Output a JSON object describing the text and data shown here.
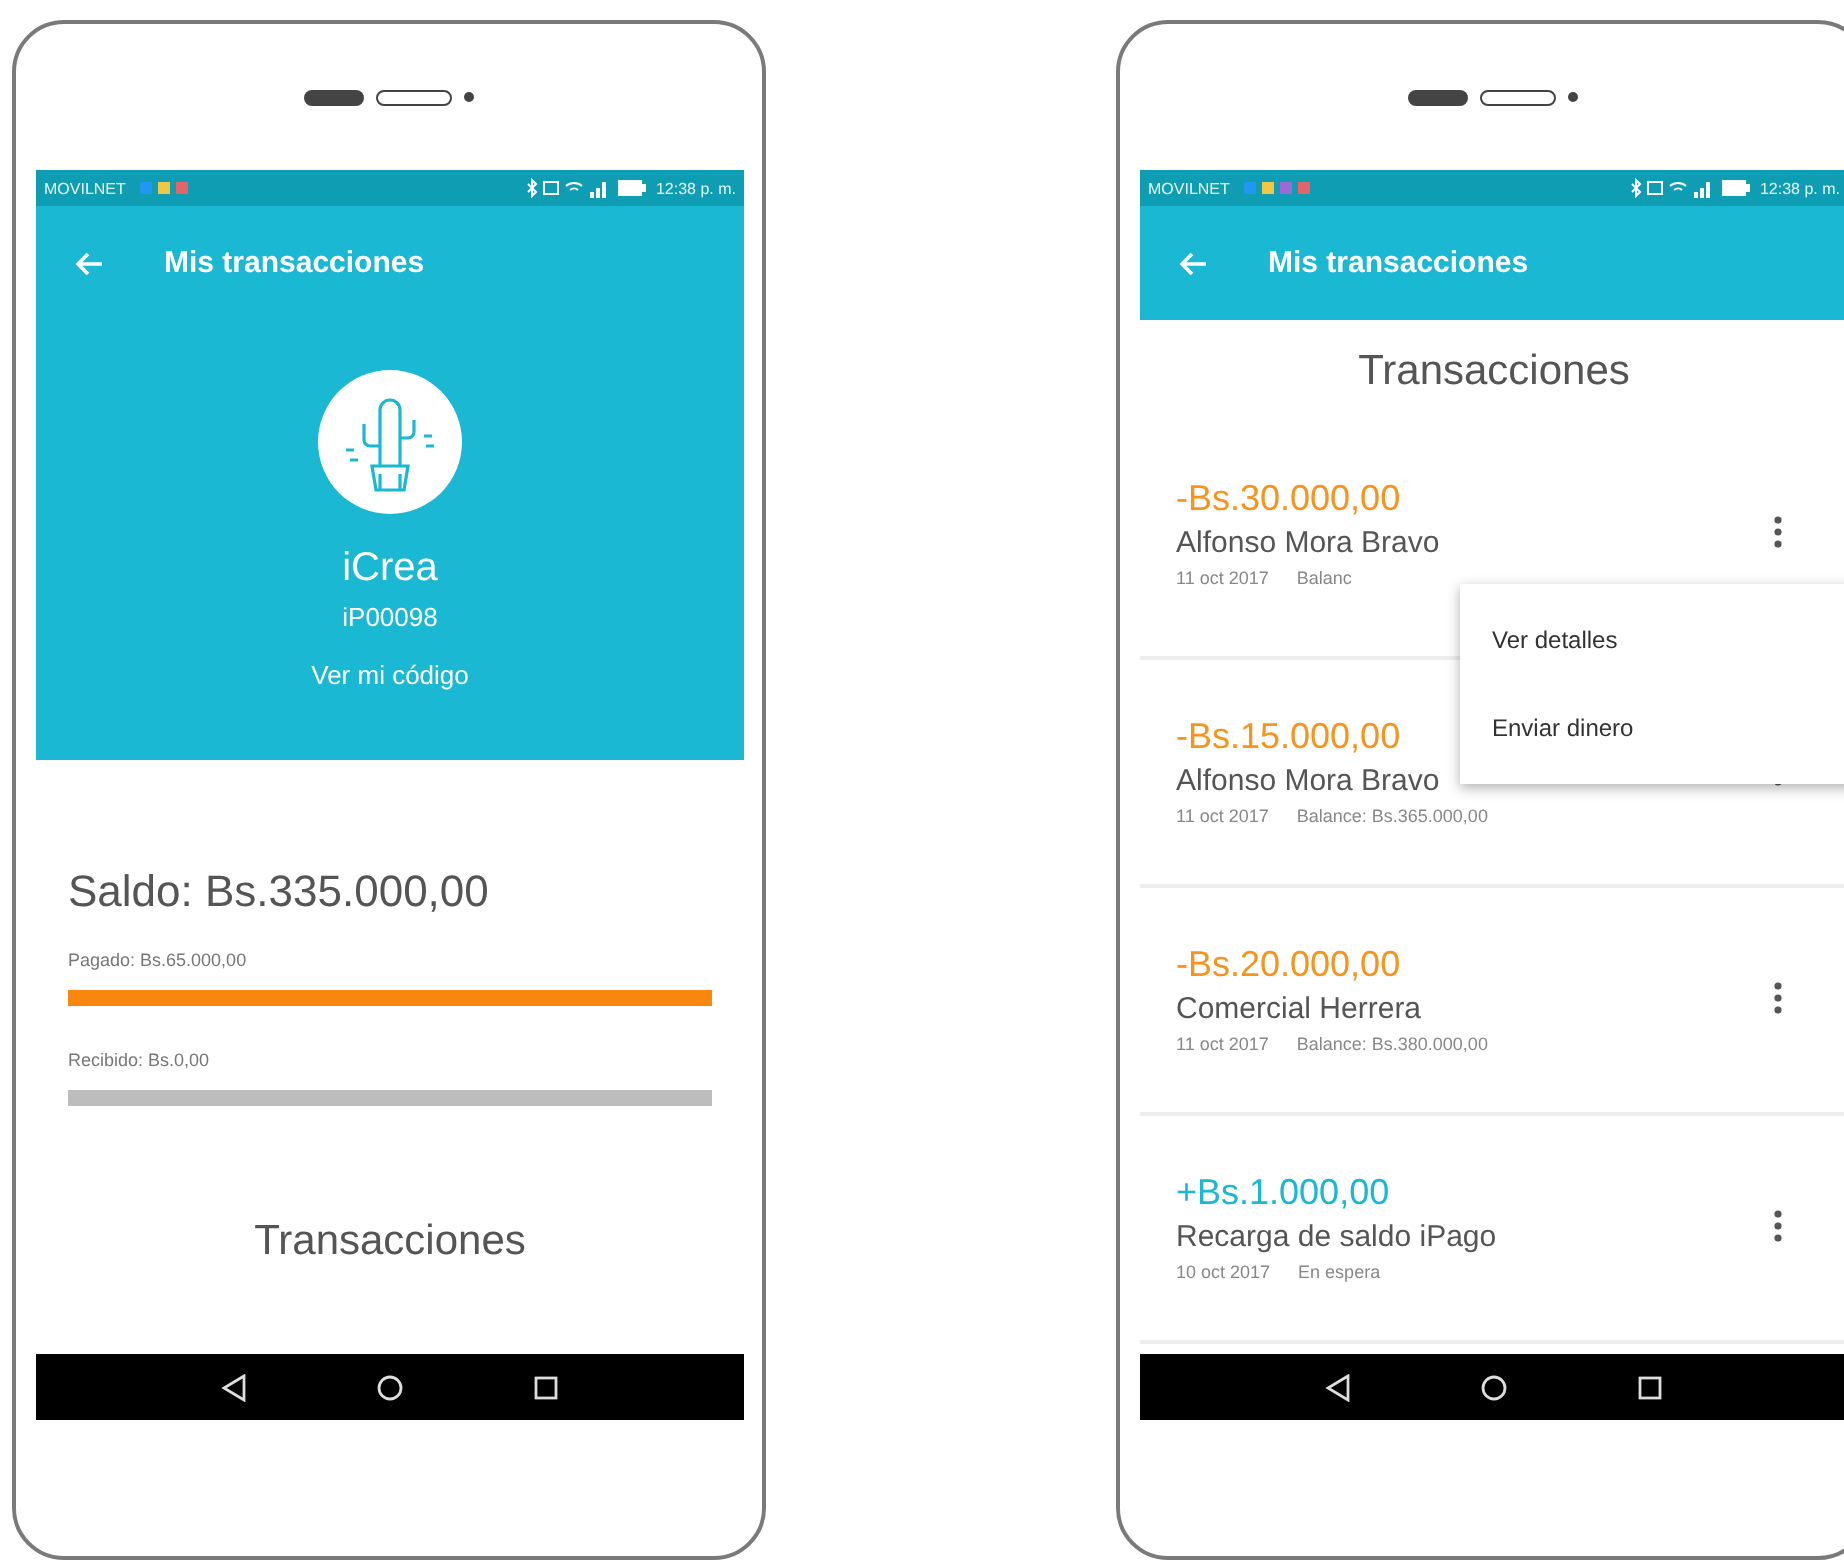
{
  "phones": [
    {
      "kind": "profile",
      "status_bar": {
        "carrier": "MOVILNET",
        "time": "12:38 p. m.",
        "notifications": [
          {
            "color": "#2196f3"
          },
          {
            "color": "#f2c744"
          },
          {
            "color": "#e5636b"
          }
        ]
      },
      "app_bar": {
        "title": "Mis transacciones"
      },
      "profile": {
        "name": "iCrea",
        "code": "iP00098",
        "link": "Ver mi código"
      },
      "balance": {
        "title": "Saldo: Bs.335.000,00",
        "meters": [
          {
            "label": "Pagado: Bs.65.000,00",
            "level": 1,
            "color": "#f7880d"
          },
          {
            "label": "Recibido: Bs.0,00",
            "level": 1,
            "color": "#bdbdbd"
          }
        ]
      },
      "section_title": "Transacciones"
    },
    {
      "kind": "list",
      "status_bar": {
        "carrier": "MOVILNET",
        "time": "12:38 p. m.",
        "notifications": [
          {
            "color": "#2196f3"
          },
          {
            "color": "#f2c744"
          },
          {
            "color": "#9c6ad6"
          },
          {
            "color": "#e5636b"
          }
        ]
      },
      "app_bar": {
        "title": "Mis transacciones"
      },
      "section_title": "Transacciones",
      "transactions": [
        {
          "amount": "-Bs.30.000,00",
          "color": "#f7941d",
          "name": "Alfonso Mora Bravo",
          "date": "11 oct 2017",
          "note": "Balanc"
        },
        {
          "amount": "-Bs.15.000,00",
          "color": "#f7941d",
          "name": "Alfonso Mora Bravo",
          "date": "11 oct 2017",
          "note": "Balance: Bs.365.000,00"
        },
        {
          "amount": "-Bs.20.000,00",
          "color": "#f7941d",
          "name": "Comercial Herrera",
          "date": "11 oct 2017",
          "note": "Balance: Bs.380.000,00"
        },
        {
          "amount": "+Bs.1.000,00",
          "color": "#1ab8d2",
          "name": "Recarga de saldo iPago",
          "date": "10 oct 2017",
          "note": "En espera"
        }
      ],
      "menu": {
        "items": [
          "Ver detalles",
          "Enviar dinero"
        ]
      }
    }
  ]
}
